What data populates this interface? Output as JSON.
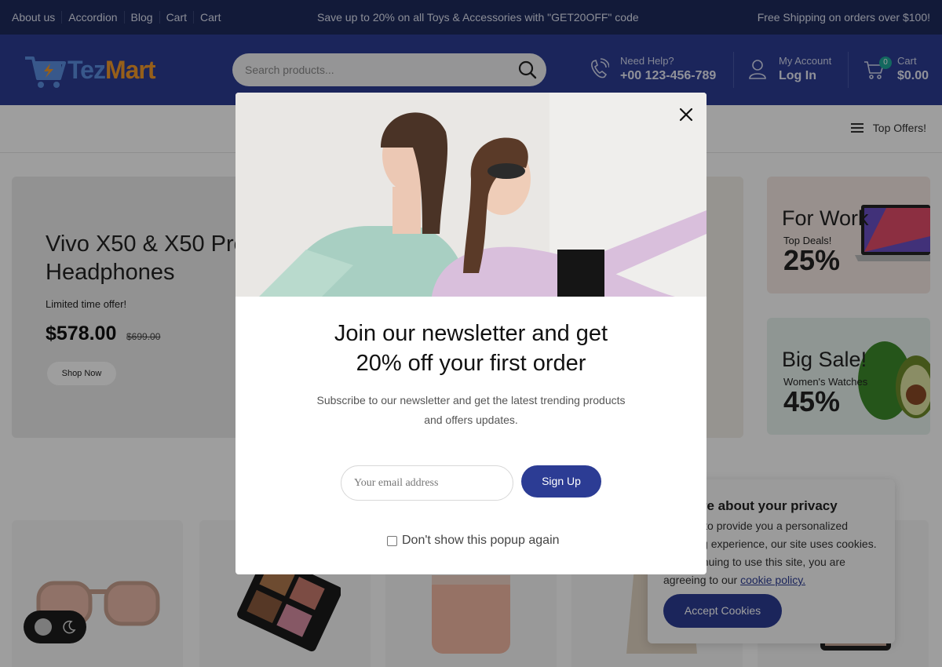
{
  "topbar": {
    "links": [
      "About us",
      "Accordion",
      "Blog",
      "Cart",
      "Cart"
    ],
    "promo": "Save up to 20% on all Toys & Accessories with \"GET20OFF\" code",
    "shipping": "Free Shipping on orders over $100!"
  },
  "header": {
    "logo": {
      "part1": "Tez",
      "part2": "Mart"
    },
    "search_placeholder": "Search products...",
    "help": {
      "label": "Need Help?",
      "phone": "+00 123-456-789"
    },
    "account": {
      "label": "My Account",
      "action": "Log In"
    },
    "cart": {
      "label": "Cart",
      "total": "$0.00",
      "count": "0"
    }
  },
  "nav": {
    "top_offers": "Top Offers!"
  },
  "hero": {
    "title": "Vivo X50 & X50 Pro Headphones",
    "tagline": "Limited time offer!",
    "price": "$578.00",
    "old_price": "$699.00",
    "button": "Shop Now"
  },
  "promos": [
    {
      "heading": "For Work",
      "sub": "Top Deals!",
      "percent": "25%"
    },
    {
      "heading": "Big Sale!",
      "sub": "Women's Watches",
      "percent": "45%"
    }
  ],
  "modal": {
    "title_line1": "Join our newsletter and get",
    "title_line2": "20% off your first order",
    "subtitle": "Subscribe to our newsletter and get the latest trending products and offers updates.",
    "email_placeholder": "Your email address",
    "button": "Sign Up",
    "dont_show": "Don't show this popup again"
  },
  "cookie": {
    "title": "We care about your privacy",
    "body": "In order to provide you a personalized shopping experience, our site uses cookies. By continuing to use this site, you are agreeing to our ",
    "link": "cookie policy.",
    "button": "Accept Cookies"
  },
  "colors": {
    "navy": "#1d2a5c",
    "brand_blue": "#2c3c94",
    "logo_orange": "#f39a2a",
    "badge_teal": "#1fa89a"
  }
}
